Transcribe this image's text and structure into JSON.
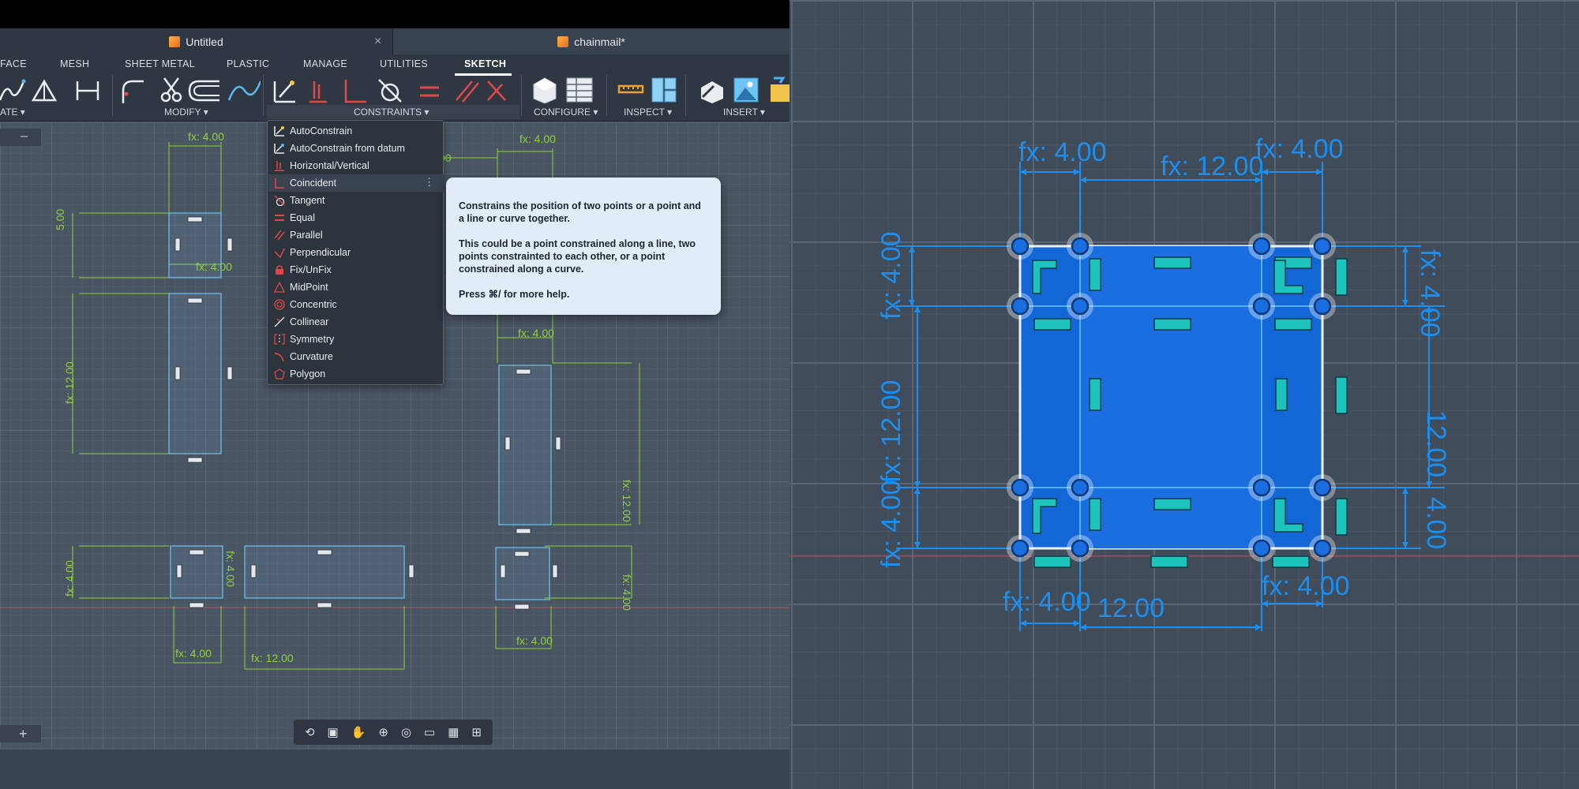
{
  "left_pane": {
    "document_tabs": [
      {
        "label": "Untitled"
      },
      {
        "label": "chainmail*"
      }
    ],
    "close_symbol": "×",
    "ribbon_tabs": [
      "FACE",
      "MESH",
      "SHEET METAL",
      "PLASTIC",
      "MANAGE",
      "UTILITIES",
      "SKETCH"
    ],
    "active_tab": "SKETCH",
    "groups": {
      "create": "ATE ▾",
      "modify": "MODIFY ▾",
      "constraints": "CONSTRAINTS ▾",
      "configure": "CONFIGURE ▾",
      "inspect": "INSPECT ▾",
      "insert": "INSERT ▾"
    },
    "collapse_minus": "–",
    "add_plus": "+",
    "constraints_menu": [
      {
        "label": "AutoConstrain",
        "icon": "autoconstrain-icon"
      },
      {
        "label": "AutoConstrain from datum",
        "icon": "autoconstrain-datum-icon"
      },
      {
        "label": "Horizontal/Vertical",
        "icon": "horizontal-vertical-icon"
      },
      {
        "label": "Coincident",
        "icon": "coincident-icon",
        "highlighted": true,
        "more": "⋮"
      },
      {
        "label": "Tangent",
        "icon": "tangent-icon"
      },
      {
        "label": "Equal",
        "icon": "equal-icon"
      },
      {
        "label": "Parallel",
        "icon": "parallel-icon"
      },
      {
        "label": "Perpendicular",
        "icon": "perpendicular-icon"
      },
      {
        "label": "Fix/UnFix",
        "icon": "lock-icon"
      },
      {
        "label": "MidPoint",
        "icon": "midpoint-icon"
      },
      {
        "label": "Concentric",
        "icon": "concentric-icon"
      },
      {
        "label": "Collinear",
        "icon": "collinear-icon"
      },
      {
        "label": "Symmetry",
        "icon": "symmetry-icon"
      },
      {
        "label": "Curvature",
        "icon": "curvature-icon"
      },
      {
        "label": "Polygon",
        "icon": "polygon-icon"
      }
    ],
    "tooltip": {
      "p1": "Constrains the position of two points or a point and a line or curve together.",
      "p2": "This could be a point constrained along a line, two points constrainted to each other, or a point constrained along a curve.",
      "p3": "Press ⌘/ for more help."
    },
    "dimensions": {
      "fx4": "fx: 4.00",
      "fx12": "fx: 12.00",
      "d5": "5.00",
      "d00": "00"
    },
    "nav_bar_icons": [
      "orbit-icon",
      "look-at-icon",
      "pan-icon",
      "zoom-icon",
      "fit-icon",
      "display-settings-icon",
      "grid-icon",
      "viewports-icon"
    ]
  },
  "right_pane": {
    "dimensions": {
      "fx4": "fx: 4.00",
      "fx12": "fx: 12.00",
      "d12": "12.00",
      "fx12_partial": "fx: 12.00",
      "fx4_partial": "fx: 4.00",
      "d00_partial": "12.00",
      "d400": "4.00"
    }
  },
  "colors": {
    "dimension_green": "#8fd13a",
    "dimension_blue": "#1a8ff0",
    "selection_fill": "#1266d6",
    "sketch_line_blue": "#6cc4f0"
  }
}
